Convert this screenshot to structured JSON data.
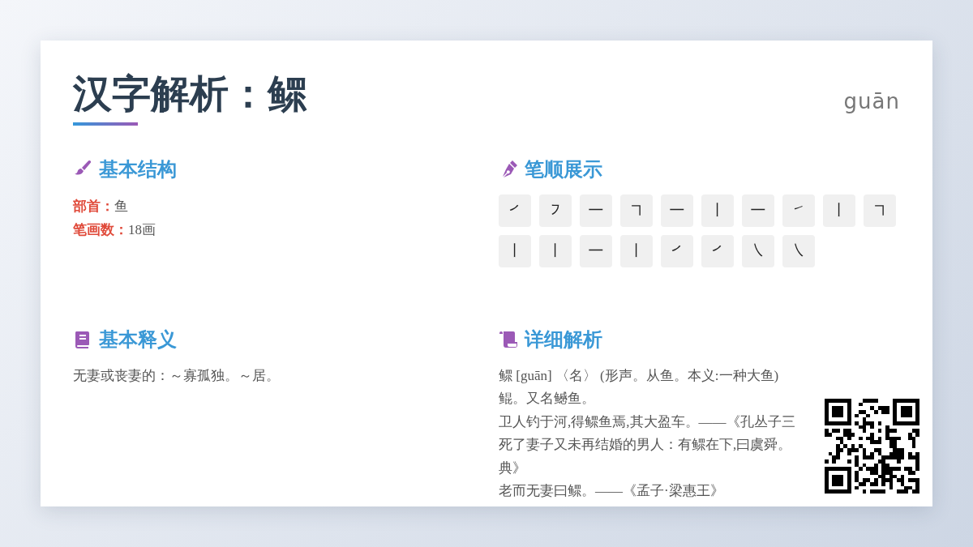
{
  "title": "汉字解析：鳏",
  "pinyin": "guān",
  "sections": [
    {
      "kind": "structure",
      "heading": "基本结构",
      "fields": [
        {
          "label": "部首：",
          "value": "鱼"
        },
        {
          "label": "笔画数：",
          "value": "18画"
        }
      ]
    },
    {
      "kind": "strokes",
      "heading": "笔顺展示",
      "strokes": [
        "㇒",
        "㇇",
        "㇐",
        "㇕",
        "㇐",
        "丨",
        "㇐",
        "㇀",
        "丨",
        "㇕",
        "丨",
        "丨",
        "㇐",
        "丨",
        "㇒",
        "㇒",
        "㇏",
        "㇏"
      ]
    },
    {
      "kind": "text",
      "heading": "基本释义",
      "lines": [
        "无妻或丧妻的：～寡孤独。～居。"
      ]
    },
    {
      "kind": "text",
      "heading": "详细解析",
      "lines": [
        "鳏 [guān] 〈名〉 (形声。从鱼。本义:一种大鱼)",
        "鲲。又名鳡鱼。",
        "卫人钓于河,得鳏鱼焉,其大盈车。——《孔丛子三",
        "死了妻子又未再结婚的男人：有鳏在下,曰虞舜。",
        "典》",
        "老而无妻曰鳏。——《孟子·梁惠王》"
      ]
    }
  ]
}
